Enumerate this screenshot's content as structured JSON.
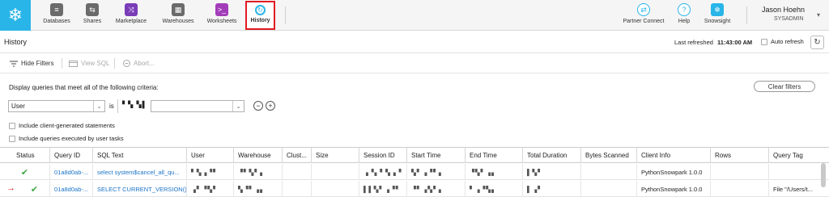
{
  "nav": {
    "logo": "❄",
    "items": [
      {
        "label": "Databases",
        "icon": "database-icon",
        "glyph": "≡",
        "color": "#6b6b6b"
      },
      {
        "label": "Shares",
        "icon": "shares-icon",
        "glyph": "⇆",
        "color": "#6b6b6b"
      },
      {
        "label": "Marketplace",
        "icon": "marketplace-icon",
        "glyph": "⤨",
        "color": "#7a3db8"
      },
      {
        "label": "Warehouses",
        "icon": "warehouse-icon",
        "glyph": "▦",
        "color": "#6b6b6b"
      },
      {
        "label": "Worksheets",
        "icon": "worksheet-icon",
        "glyph": ">_",
        "color": "#a23db8"
      },
      {
        "label": "History",
        "icon": "history-icon",
        "glyph": "↻",
        "color": "#29b5e8"
      }
    ],
    "right_items": [
      {
        "label": "Partner Connect",
        "icon": "partner-connect-icon",
        "glyph": "⇄",
        "color": "#29b5e8"
      },
      {
        "label": "Help",
        "icon": "help-icon",
        "glyph": "?",
        "color": "#29b5e8"
      },
      {
        "label": "Snowsight",
        "icon": "snowsight-icon",
        "glyph": "❄",
        "color": "#29b5e8"
      }
    ],
    "user_name": "Jason Hoehn",
    "user_role": "SYSADMIN",
    "user_chevron": "▾"
  },
  "history_bar": {
    "title": "History",
    "last_refreshed_label": "Last refreshed",
    "last_refreshed_time": "11:43:00 AM",
    "auto_refresh_label": "Auto refresh",
    "refresh_glyph": "↻"
  },
  "toolbar": {
    "hide_filters": "Hide Filters",
    "view_sql": "View SQL",
    "abort": "Abort..."
  },
  "filters": {
    "criteria_text": "Display queries that meet all of the following criteria:",
    "clear_filters": "Clear filters",
    "field_value": "User",
    "operator": "is",
    "user_value_masked": "▘▚ ▚▌",
    "include_client": "Include client-generated statements",
    "include_tasks": "Include queries executed by user tasks",
    "chevron": "⌄",
    "remove_glyph": "−",
    "add_glyph": "+"
  },
  "table": {
    "columns": [
      "Status",
      "Query ID",
      "SQL Text",
      "User",
      "Warehouse",
      "Clust...",
      "Size",
      "Session ID",
      "Start Time",
      "End Time",
      "Total Duration",
      "Bytes Scanned",
      "Client Info",
      "Rows",
      "Query Tag"
    ],
    "rows": [
      {
        "status": "✔",
        "query_id": "01a8d0ab-...",
        "sql_text": "select system$cancel_all_qu...",
        "user": "▘▚▗▝▘",
        "warehouse": "▝▘▚▘▖",
        "clust": "",
        "size": "",
        "session_id": "▗▝▖▘▚▗▝",
        "start_time": "▚▘▗▝▘▖",
        "end_time": "▝▚▘▗▖",
        "total_duration": "▌▚▘",
        "bytes_scanned": "",
        "client_info": "PythonSnowpark 1.0.0",
        "rows": "",
        "query_tag": ""
      },
      {
        "status": "✔",
        "query_id": "01a8d0ab-...",
        "sql_text": "SELECT CURRENT_VERSION()",
        "user": "▗▘▝▚▘",
        "warehouse": "▚▝▘▗▖",
        "clust": "",
        "size": "",
        "session_id": "▌▌▚▘▗▝▘",
        "start_time": "▝▘▗▚▘▖",
        "end_time": "▘▗▝▚▖",
        "total_duration": "▌▗▘",
        "bytes_scanned": "",
        "client_info": "PythonSnowpark 1.0.0",
        "rows": "",
        "query_tag": "File \"/Users/t..."
      }
    ],
    "arrow": "→"
  }
}
